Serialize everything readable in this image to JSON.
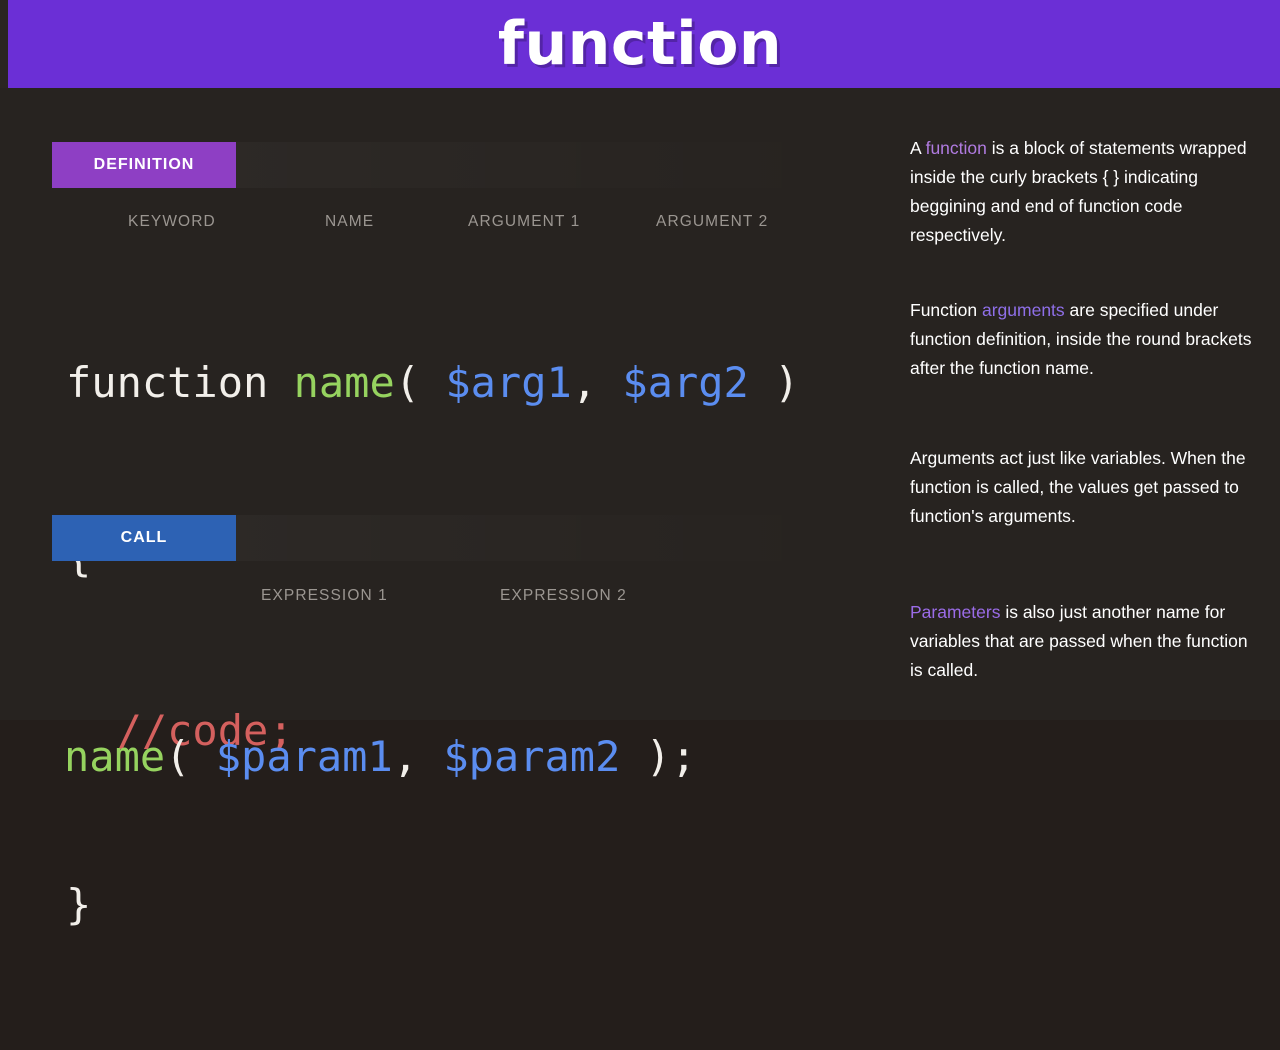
{
  "banner": {
    "title": "function"
  },
  "sections": {
    "definition": {
      "label": "DEFINITION",
      "annotations": {
        "keyword": "KEYWORD",
        "name": "NAME",
        "argument1": "ARGUMENT 1",
        "argument2": "ARGUMENT 2"
      },
      "code": {
        "keyword": "function",
        "name": "name",
        "paren_open": "(",
        "arg1": "$arg1",
        "comma": ",",
        "arg2": "$arg2",
        "paren_close": ")",
        "brace_open": "{",
        "comment": "//code;",
        "brace_close": "}"
      }
    },
    "call": {
      "label": "CALL",
      "annotations": {
        "expression1": "EXPRESSION 1",
        "expression2": "EXPRESSION 2"
      },
      "code": {
        "name": "name",
        "paren_open": "(",
        "param1": "$param1",
        "comma": ",",
        "param2": "$param2",
        "paren_close": ")",
        "semicolon": ";"
      }
    }
  },
  "notes": [
    {
      "id": "note-definition",
      "pre": "A ",
      "highlight": "function",
      "post": " is a block of statements wrapped inside the curly brackets { } indicating beggining and end of function code respectively."
    },
    {
      "id": "note-arguments",
      "pre": "Function ",
      "highlight": "arguments",
      "post": " are specified under function definition, inside the round brackets after the function name."
    },
    {
      "id": "note-arguments-behavior",
      "pre": "",
      "highlight": "",
      "post": "Arguments act just like variables. When the function is called, the values get passed to function's arguments."
    },
    {
      "id": "note-parameters",
      "pre": "",
      "highlight": "Parameters",
      "post": " is also just another name for variables that are passed when the function is called."
    }
  ],
  "colors": {
    "banner_bg": "#6b2fd6",
    "page_bg": "#272320",
    "definition_chip": "#8e3fc4",
    "call_chip": "#2d62b4",
    "code_name": "#96d35f",
    "code_var": "#5b8df0",
    "code_comment": "#d4605e",
    "annotation_text": "#9b9691"
  }
}
